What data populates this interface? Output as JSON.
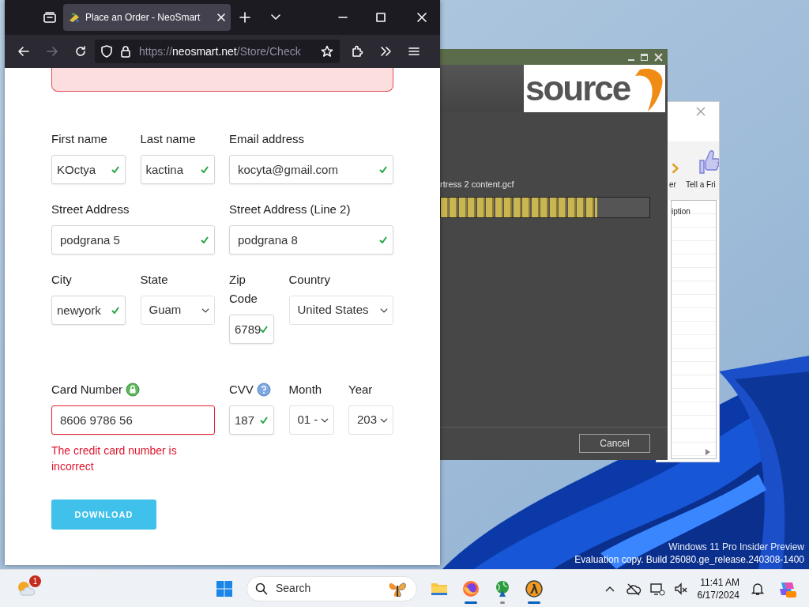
{
  "browser": {
    "tab_title": "Place an Order - NeoSmart",
    "url_scheme": "https://",
    "url_host": "neosmart.net",
    "url_path": "/Store/Check",
    "forward_disabled": true,
    "form": {
      "rows": [
        [
          {
            "label": "First name",
            "kind": "text",
            "value": "KOctya",
            "valid": true
          },
          {
            "label": "Last name",
            "kind": "text",
            "value": "kactina",
            "valid": true
          },
          {
            "label": "Email address",
            "kind": "text",
            "value": "kocyta@gmail.com",
            "valid": true
          }
        ],
        [
          {
            "label": "Street Address",
            "kind": "text",
            "value": "podgrana 5",
            "valid": true
          },
          {
            "label": "Street Address (Line 2)",
            "kind": "text",
            "value": "podgrana 8",
            "valid": true
          }
        ],
        [
          {
            "label": "City",
            "kind": "text",
            "value": "newyork",
            "valid": true
          },
          {
            "label": "State",
            "kind": "select",
            "value": "Guam"
          },
          {
            "label": "Zip Code",
            "kind": "text",
            "value": "6789",
            "valid": true
          },
          {
            "label": "Country",
            "kind": "select",
            "value": "United States"
          }
        ],
        [
          {
            "label": "Card Number",
            "kind": "card",
            "value": "8606 9786 56",
            "valid": false,
            "error": "The credit card number is incorrect"
          },
          {
            "label": "CVV",
            "kind": "cvv",
            "value": "187",
            "valid": true
          },
          {
            "label": "Month",
            "kind": "select",
            "value": "01 -"
          },
          {
            "label": "Year",
            "kind": "select",
            "value": "203"
          }
        ]
      ],
      "submit": "DOWNLOAD"
    }
  },
  "installer": {
    "logo_text": "source",
    "file_label": "rtress 2 content.gcf",
    "progress": {
      "level": 0.75
    },
    "cancel": "Cancel"
  },
  "back_window": {
    "toolbar": [
      {
        "kind": "arrow",
        "label": "er"
      },
      {
        "kind": "thumbs",
        "label": "Tell a Fri"
      }
    ],
    "list_header": "iption"
  },
  "os_notice": [
    "Windows 11 Pro Insider Preview",
    "Evaluation copy. Build 26080.ge_release.240308-1400"
  ],
  "taskbar": {
    "weather_badge": "1",
    "search_placeholder": "Search",
    "apps": [
      {
        "kind": "explorer",
        "running": false,
        "active": false
      },
      {
        "kind": "firefox",
        "running": true,
        "active": true
      },
      {
        "kind": "globe",
        "running": true,
        "active": false
      },
      {
        "kind": "lambda",
        "running": true,
        "active": true
      }
    ],
    "time": "11:41 AM",
    "date": "6/17/2024"
  }
}
